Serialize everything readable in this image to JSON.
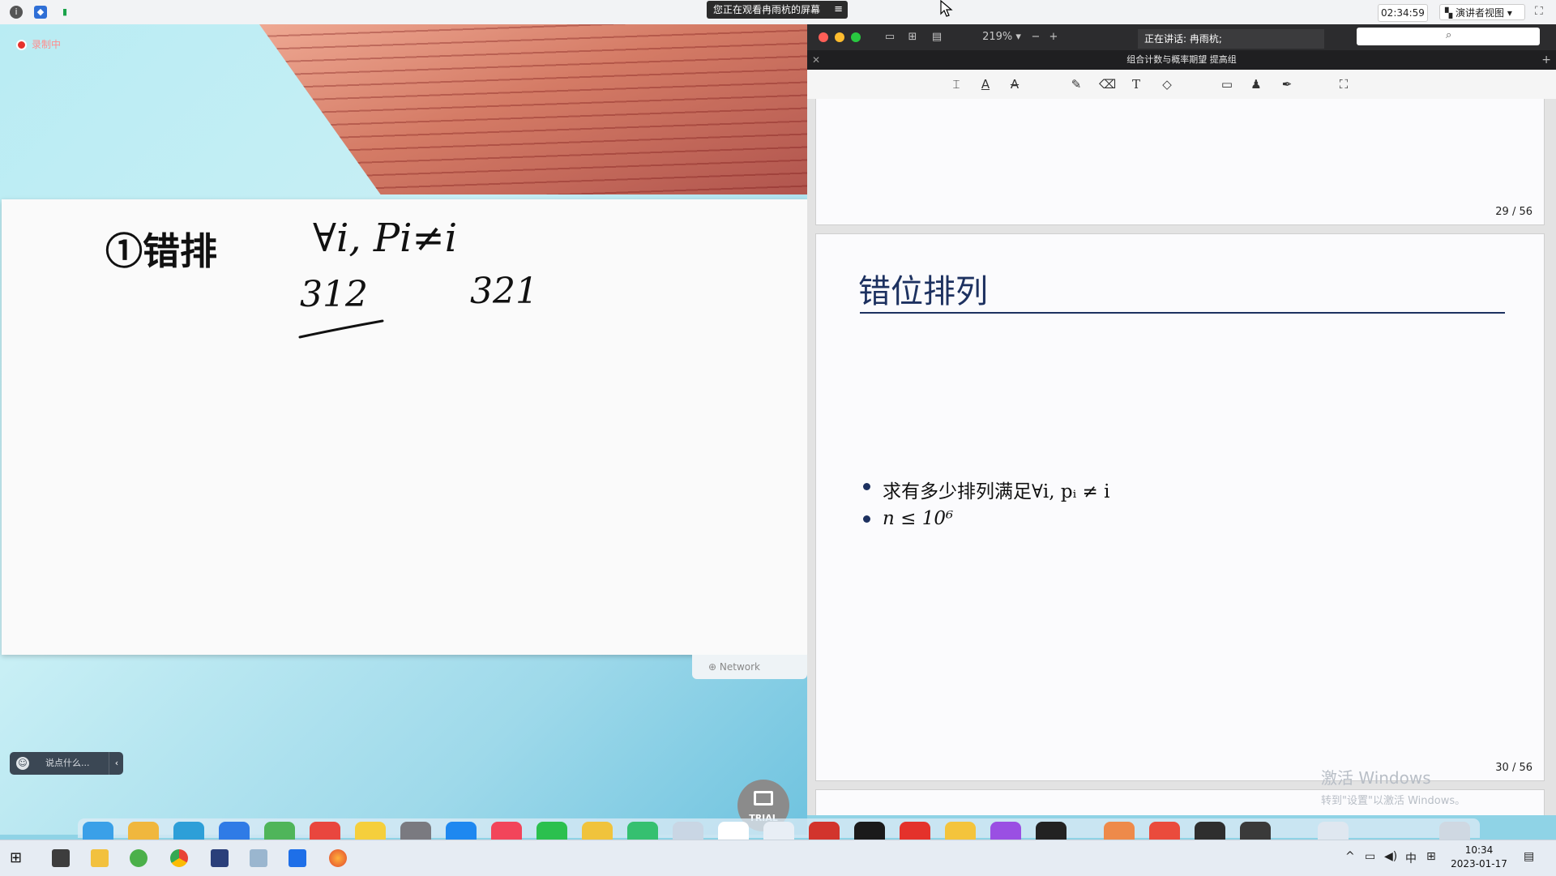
{
  "top_bar": {
    "share_banner": "您正在观看冉雨杭的屏幕",
    "timer": "02:34:59",
    "presenter_view": "演讲者视图"
  },
  "left_panel": {
    "recording_label": "录制中",
    "trial_badge": "TRIAL",
    "network_label": "Network",
    "chat_placeholder": "说点什么..."
  },
  "whiteboard": {
    "line1_a": "①错排",
    "line1_b": "∀i, Pi≠i",
    "line2_a": "312",
    "line2_b": "321"
  },
  "pdf": {
    "zoom": "219%",
    "speaking": "正在讲话: 冉雨杭;",
    "tab_title": "组合计数与概率期望 提高组",
    "page_prev": "29 / 56",
    "page_current": "30 / 56",
    "slide_title": "错位排列",
    "bullet1": "求有多少排列满足∀i, pᵢ ≠ i",
    "bullet2": "n ≤ 10⁶"
  },
  "watermark": {
    "line1": "激活 Windows",
    "line2": "转到\"设置\"以激活 Windows。"
  },
  "taskbar": {
    "ime": "中",
    "time": "10:34",
    "date": "2023-01-17"
  },
  "colors": {
    "slide_blue": "#1d3160",
    "record_red": "#e5322d"
  }
}
